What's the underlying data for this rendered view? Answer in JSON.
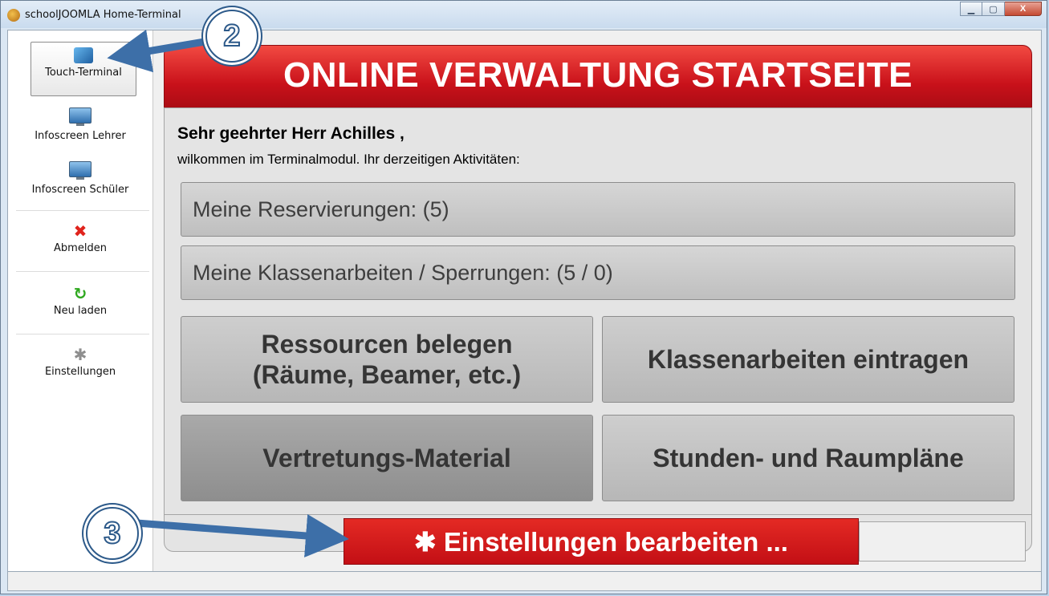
{
  "window": {
    "title": "schoolJOOMLA Home-Terminal",
    "minimize": "▁",
    "maximize": "▢",
    "close": "X"
  },
  "sidebar": {
    "items": [
      {
        "label": "Touch-Terminal",
        "icon": "touch-terminal-icon",
        "selected": true
      },
      {
        "label": "Infoscreen Lehrer",
        "icon": "monitor-icon"
      },
      {
        "label": "Infoscreen Schüler",
        "icon": "monitor-icon"
      },
      {
        "label": "Abmelden",
        "icon": "close-icon",
        "glyph": "✖"
      },
      {
        "label": "Neu laden",
        "icon": "reload-icon",
        "glyph": "↻"
      },
      {
        "label": "Einstellungen",
        "icon": "gear-icon",
        "glyph": "✱"
      }
    ]
  },
  "main": {
    "header": "ONLINE VERWALTUNG STARTSEITE",
    "greeting": "Sehr geehrter Herr Achilles ,",
    "subtitle": "wilkommen im Terminalmodul. Ihr derzeitigen Aktivitäten:",
    "reservations": "Meine Reservierungen: (5)",
    "exams": "Meine Klassenarbeiten / Sperrungen: (5 / 0)",
    "tiles": [
      {
        "line1": "Ressourcen belegen",
        "line2": "(Räume, Beamer, etc.)"
      },
      {
        "line1": "Klassenarbeiten eintragen"
      },
      {
        "line1": "Vertretungs-Material"
      },
      {
        "line1": "Stunden- und Raumpläne"
      }
    ],
    "settings_button": "✱ Einstellungen bearbeiten ..."
  },
  "callouts": {
    "two": "2",
    "three": "3",
    "color": "#3d6fa8"
  },
  "colors": {
    "brand_red": "#d21b1f",
    "tile_gray": "#c4c4c4"
  }
}
